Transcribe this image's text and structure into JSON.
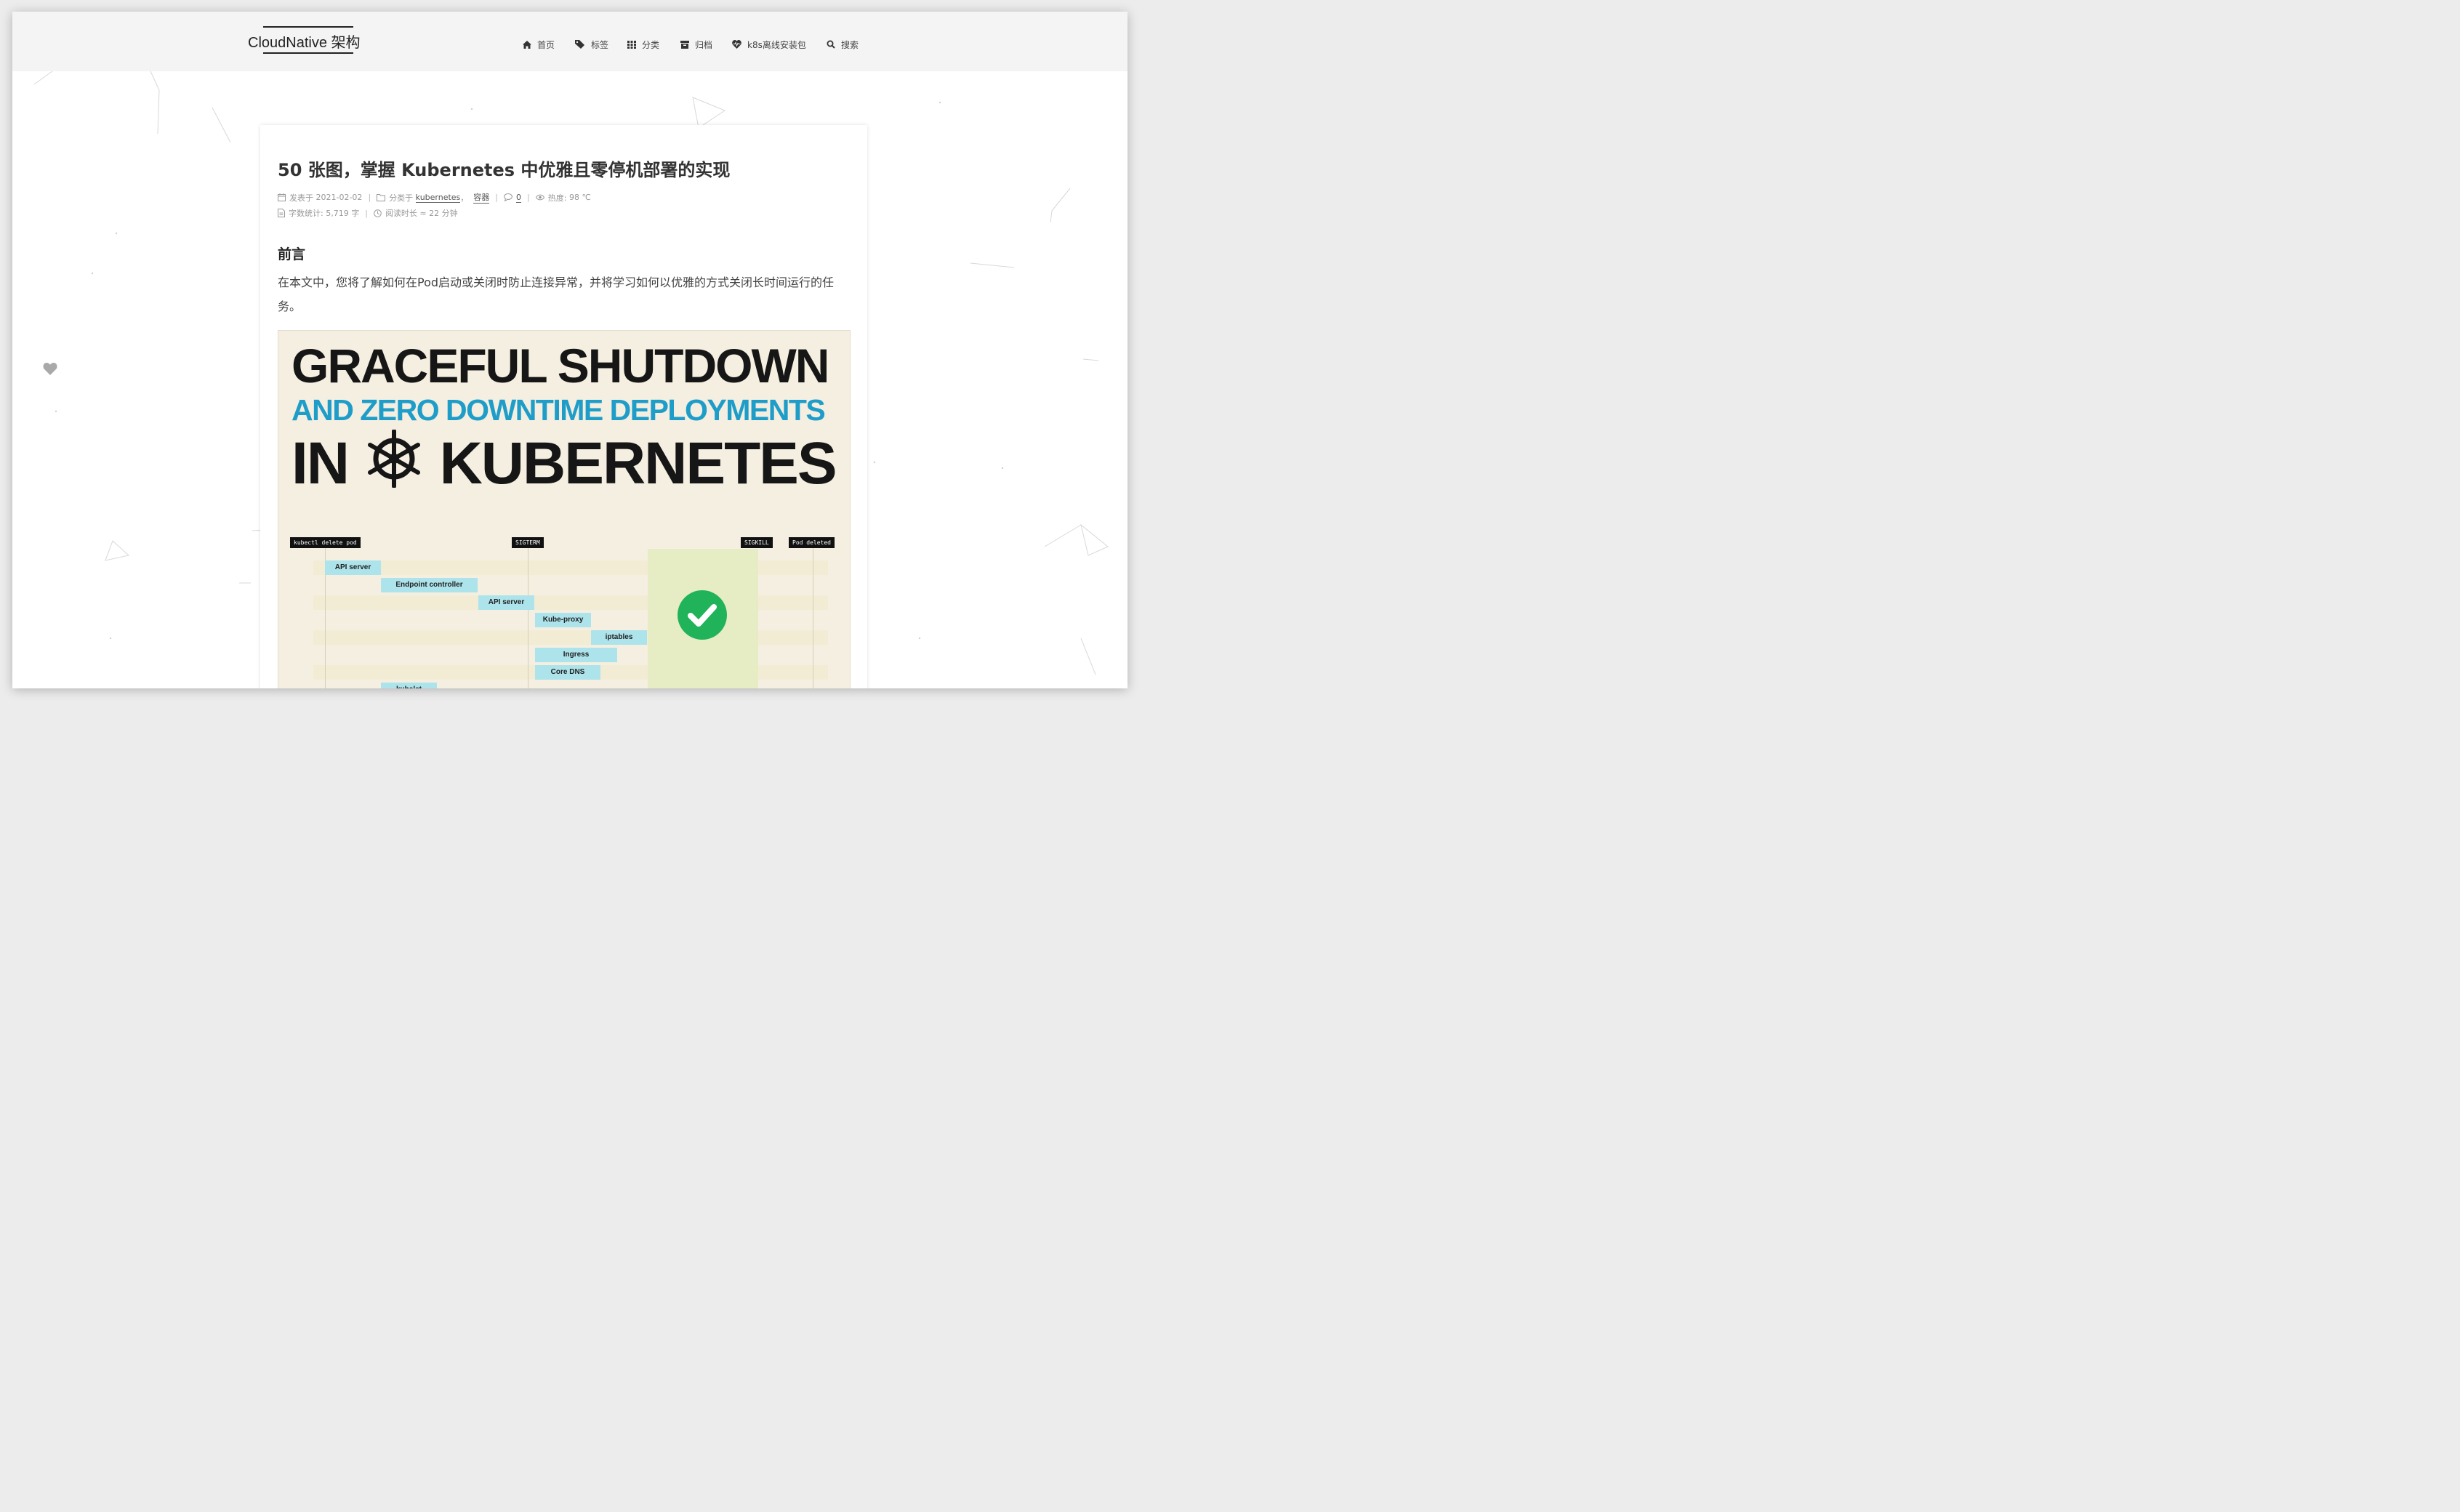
{
  "site": {
    "brand": "CloudNative 架构"
  },
  "nav": [
    {
      "icon": "home-icon",
      "label": "首页"
    },
    {
      "icon": "tags-icon",
      "label": "标签"
    },
    {
      "icon": "grid-icon",
      "label": "分类"
    },
    {
      "icon": "archive-icon",
      "label": "归档"
    },
    {
      "icon": "heartbeat-icon",
      "label": "k8s离线安装包"
    },
    {
      "icon": "search-icon",
      "label": "搜索"
    }
  ],
  "post": {
    "title": "50 张图，掌握 Kubernetes 中优雅且零停机部署的实现",
    "meta": {
      "published_label": "发表于",
      "published_date": "2021-02-02",
      "category_label": "分类于",
      "category_1": "kubernetes",
      "category_sep": "，",
      "category_2": "容器",
      "comments": "0",
      "heat_label": "热度:",
      "heat_value": "98 ℃",
      "words_label": "字数统计:",
      "words_value": "5,719 字",
      "reading_label": "阅读时长 ≈",
      "reading_value": "22 分钟",
      "divider": "|"
    },
    "section_heading": "前言",
    "intro": "在本文中，您将了解如何在Pod启动或关闭时防止连接异常，并将学习如何以优雅的方式关闭长时间运行的任务。",
    "banner": {
      "line1": "GRACEFUL SHUTDOWN",
      "line2": "AND ZERO DOWNTIME DEPLOYMENTS",
      "line3_a": "IN",
      "line3_b": "KUBERNETES",
      "timeline_labels": {
        "start": "kubectl delete pod",
        "sigterm": "SIGTERM",
        "sigkill": "SIGKILL",
        "deleted": "Pod deleted"
      },
      "steps": {
        "api_server_1": "API server",
        "endpoint_controller": "Endpoint controller",
        "api_server_2": "API server",
        "kube_proxy": "Kube-proxy",
        "iptables": "iptables",
        "ingress": "Ingress",
        "core_dns": "Core DNS",
        "kubelet": "kubelet"
      }
    }
  },
  "colors": {
    "banner_bg": "#f5efe1",
    "banner_accent": "#1f9dc9",
    "step_bar": "#ade3ea",
    "check_green": "#21b35a"
  }
}
